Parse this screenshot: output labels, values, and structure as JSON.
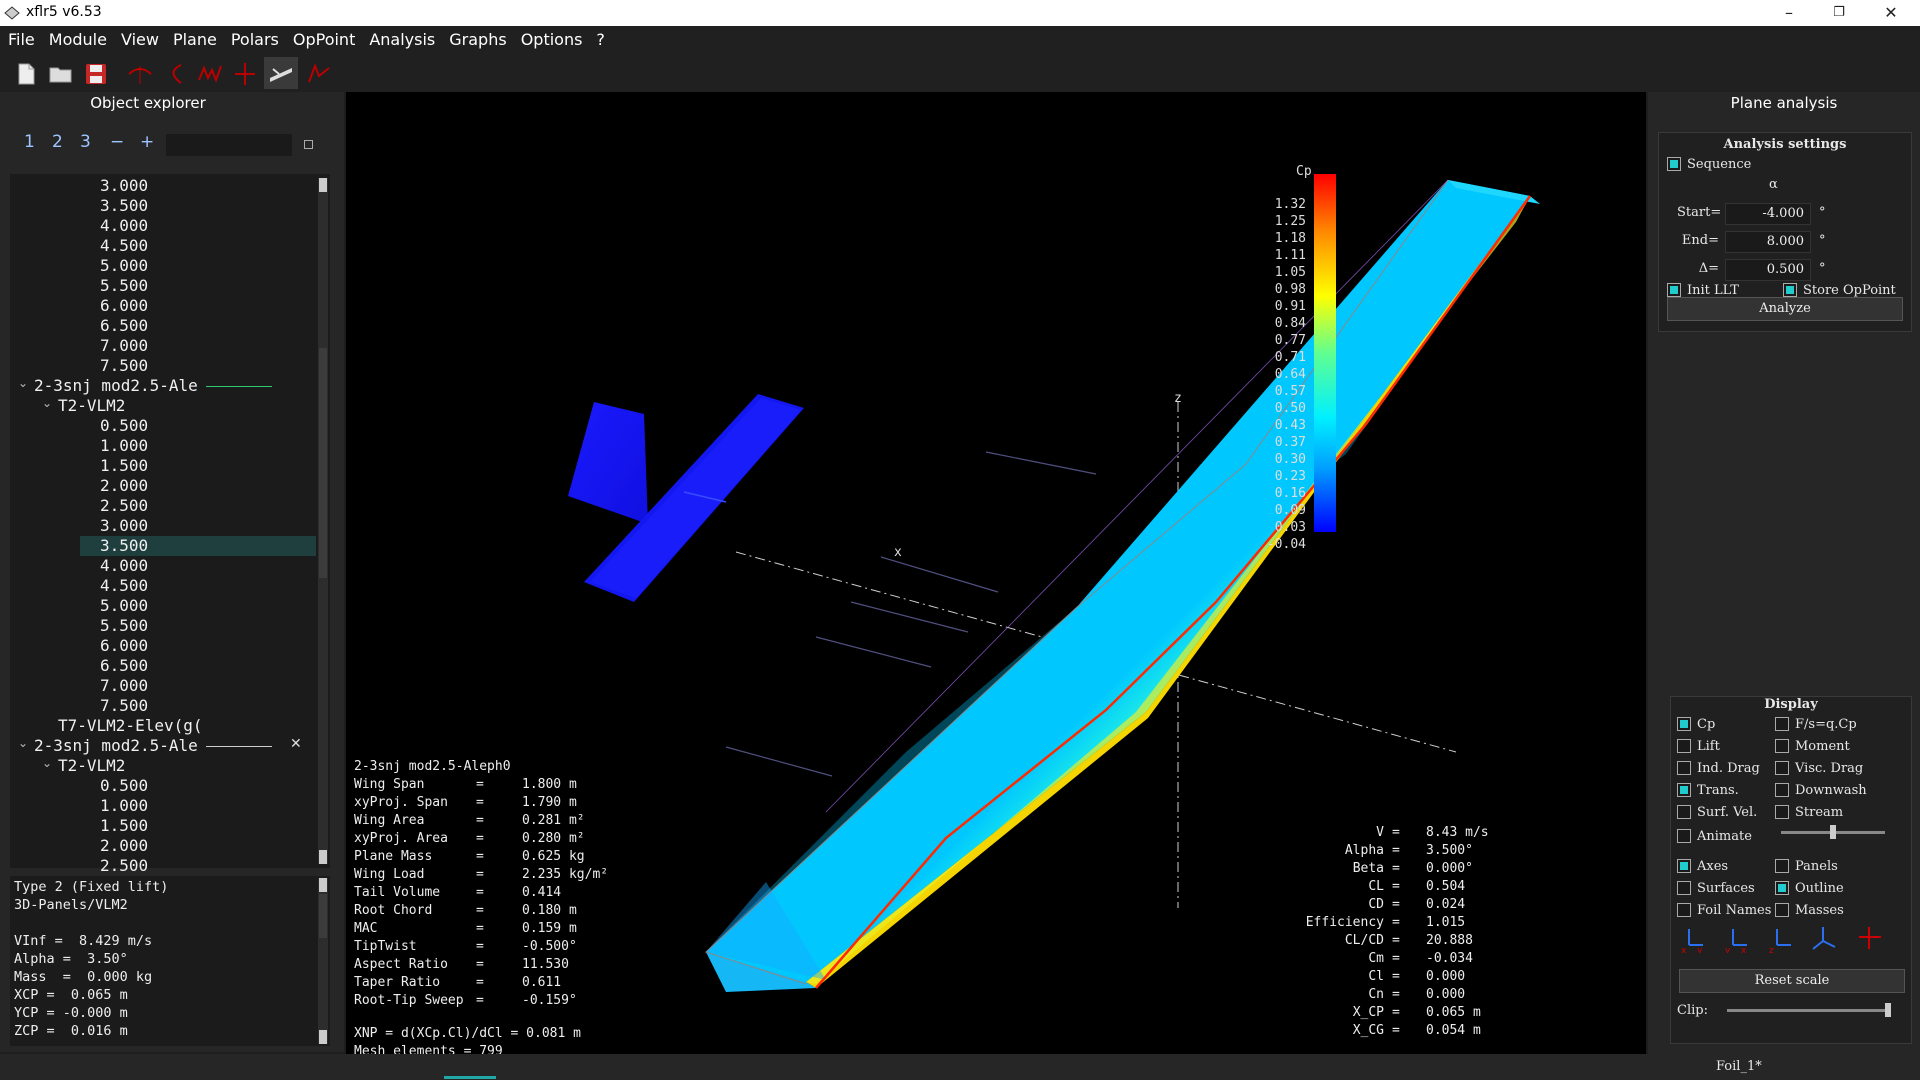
{
  "window": {
    "title": "xflr5 v6.53",
    "minimize": "–",
    "restore": "❐",
    "close": "✕"
  },
  "menu": [
    "File",
    "Module",
    "View",
    "Plane",
    "Polars",
    "OpPoint",
    "Analysis",
    "Graphs",
    "Options",
    "?"
  ],
  "toolbar": {
    "icons": [
      "new-file-icon",
      "open-folder-icon",
      "save-icon",
      "wopp-view-icon",
      "polar-view-icon",
      "cp-view-icon",
      "stability-view-icon",
      "3d-view-icon",
      "cp-3d-icon"
    ]
  },
  "explorer": {
    "title": "Object explorer",
    "view_buttons": [
      "1",
      "2",
      "3",
      "−",
      "+"
    ],
    "tree": [
      {
        "text": "3.000",
        "level": 3
      },
      {
        "text": "3.500",
        "level": 3
      },
      {
        "text": "4.000",
        "level": 3
      },
      {
        "text": "4.500",
        "level": 3
      },
      {
        "text": "5.000",
        "level": 3
      },
      {
        "text": "5.500",
        "level": 3
      },
      {
        "text": "6.000",
        "level": 3
      },
      {
        "text": "6.500",
        "level": 3
      },
      {
        "text": "7.000",
        "level": 3
      },
      {
        "text": "7.500",
        "level": 3
      },
      {
        "text": "2-3snj mod2.5-Ale",
        "level": 1,
        "expander": "⌄",
        "line": true
      },
      {
        "text": "T2-VLM2",
        "level": 2,
        "expander": "⌄"
      },
      {
        "text": "0.500",
        "level": 3
      },
      {
        "text": "1.000",
        "level": 3
      },
      {
        "text": "1.500",
        "level": 3
      },
      {
        "text": "2.000",
        "level": 3
      },
      {
        "text": "2.500",
        "level": 3
      },
      {
        "text": "3.000",
        "level": 3
      },
      {
        "text": "3.500",
        "level": 3,
        "selected": true
      },
      {
        "text": "4.000",
        "level": 3
      },
      {
        "text": "4.500",
        "level": 3
      },
      {
        "text": "5.000",
        "level": 3
      },
      {
        "text": "5.500",
        "level": 3
      },
      {
        "text": "6.000",
        "level": 3
      },
      {
        "text": "6.500",
        "level": 3
      },
      {
        "text": "7.000",
        "level": 3
      },
      {
        "text": "7.500",
        "level": 3
      },
      {
        "text": "T7-VLM2-Elev(g(",
        "level": 2
      },
      {
        "text": "2-3snj mod2.5-Ale",
        "level": 1,
        "expander": "⌄",
        "line": true,
        "close": "✕"
      },
      {
        "text": "T2-VLM2",
        "level": 2,
        "expander": "⌄"
      },
      {
        "text": "0.500",
        "level": 3
      },
      {
        "text": "1.000",
        "level": 3
      },
      {
        "text": "1.500",
        "level": 3
      },
      {
        "text": "2.000",
        "level": 3
      },
      {
        "text": "2.500",
        "level": 3
      }
    ],
    "info": [
      "Type 2 (Fixed lift)",
      "3D-Panels/VLM2",
      "",
      "VInf =  8.429 m/s",
      "Alpha =  3.50°",
      "Mass  =  0.000 kg",
      "XCP =  0.065 m",
      "YCP = -0.000 m",
      "ZCP =  0.016 m"
    ]
  },
  "viewport": {
    "plane_name": "2-3snj mod2.5-Aleph0",
    "plane_props": [
      [
        "Wing Span",
        "1.800 m"
      ],
      [
        "xyProj. Span",
        "1.790 m"
      ],
      [
        "Wing Area",
        "0.281 m²"
      ],
      [
        "xyProj. Area",
        "0.280 m²"
      ],
      [
        "Plane Mass",
        "0.625 kg"
      ],
      [
        "Wing Load",
        "2.235 kg/m²"
      ],
      [
        "Tail Volume",
        "0.414"
      ],
      [
        "Root Chord",
        "0.180 m"
      ],
      [
        "MAC",
        "0.159 m"
      ],
      [
        "TipTwist",
        "-0.500°"
      ],
      [
        "Aspect Ratio",
        "11.530"
      ],
      [
        "Taper Ratio",
        "0.611"
      ],
      [
        "Root-Tip Sweep",
        "-0.159°"
      ]
    ],
    "xnp": "XNP = d(XCp.Cl)/dCl =     0.081 m",
    "mesh": "Mesh elements  =    799",
    "results": [
      [
        "V",
        "8.43 m/s"
      ],
      [
        "Alpha",
        "3.500°"
      ],
      [
        "Beta",
        "0.000°"
      ],
      [
        "CL",
        "0.504"
      ],
      [
        "CD",
        "0.024"
      ],
      [
        "Efficiency",
        "1.015"
      ],
      [
        "CL/CD",
        "20.888"
      ],
      [
        "Cm",
        "-0.034"
      ],
      [
        "Cl",
        "0.000"
      ],
      [
        "Cn",
        "0.000"
      ],
      [
        "X_CP",
        "0.065 m"
      ],
      [
        "X_CG",
        "0.054 m"
      ]
    ],
    "legend_title": "Cp",
    "legend_ticks": [
      "1.32",
      "1.25",
      "1.18",
      "1.11",
      "1.05",
      "0.98",
      "0.91",
      "0.84",
      "0.77",
      "0.71",
      "0.64",
      "0.57",
      "0.50",
      "0.43",
      "0.37",
      "0.30",
      "0.23",
      "0.16",
      "0.09",
      "0.03",
      "-0.04"
    ],
    "axis_x": "x",
    "axis_z": "z"
  },
  "analysis": {
    "title": "Plane analysis",
    "settings_title": "Analysis settings",
    "sequence_label": "Sequence",
    "sequence_checked": true,
    "alpha_symbol": "α",
    "start_label": "Start=",
    "start_value": "-4.000",
    "end_label": "End=",
    "end_value": "8.000",
    "delta_label": "Δ=",
    "delta_value": "0.500",
    "unit": "°",
    "init_llt": "Init LLT",
    "init_llt_checked": true,
    "store_opp": "Store OpPoint",
    "store_opp_checked": true,
    "analyze": "Analyze"
  },
  "display": {
    "title": "Display",
    "options": [
      {
        "label": "Cp",
        "on": true
      },
      {
        "label": "F/s=q.Cp",
        "on": false
      },
      {
        "label": "Lift",
        "on": false
      },
      {
        "label": "Moment",
        "on": false
      },
      {
        "label": "Ind. Drag",
        "on": false
      },
      {
        "label": "Visc. Drag",
        "on": false
      },
      {
        "label": "Trans.",
        "on": true
      },
      {
        "label": "Downwash",
        "on": false
      },
      {
        "label": "Surf. Vel.",
        "on": false
      },
      {
        "label": "Stream",
        "on": false
      }
    ],
    "animate": "Animate",
    "animate_on": false,
    "animate_level": 0.5,
    "options2": [
      {
        "label": "Axes",
        "on": true
      },
      {
        "label": "Panels",
        "on": false
      },
      {
        "label": "Surfaces",
        "on": false
      },
      {
        "label": "Outline",
        "on": true
      },
      {
        "label": "Foil Names",
        "on": false
      },
      {
        "label": "Masses",
        "on": false
      }
    ],
    "view_icons": [
      "x-view-icon",
      "y-view-icon",
      "z-view-icon",
      "iso-view-icon",
      "flip-view-icon"
    ],
    "reset_scale": "Reset scale",
    "clip_label": "Clip:",
    "clip_level": 1.0
  },
  "status": {
    "text": "Foil_1*"
  },
  "colors": {
    "accent": "#22cccc",
    "selection": "#1f3f3f",
    "tail": "#1414ff",
    "curve": "#2ecc71"
  }
}
